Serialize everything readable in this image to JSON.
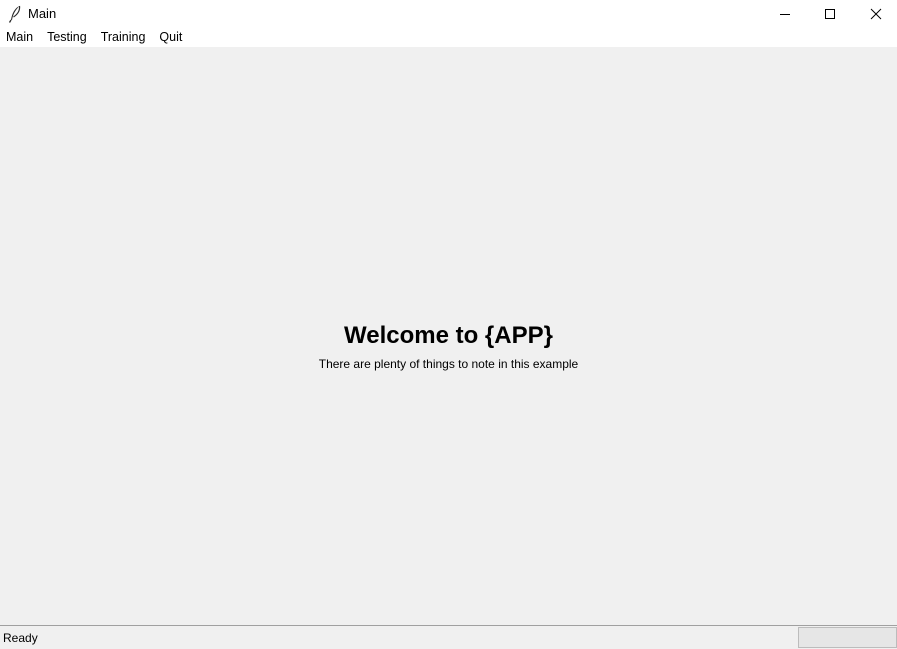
{
  "window": {
    "title": "Main",
    "icon": "feather-icon",
    "controls": [
      "minimize-icon",
      "maximize-icon",
      "close-icon"
    ]
  },
  "menu": {
    "items": [
      "Main",
      "Testing",
      "Training",
      "Quit"
    ]
  },
  "main": {
    "title": "Welcome to {APP}",
    "subtitle": "There are plenty of things to note in this example"
  },
  "status": {
    "text": "Ready",
    "progress_fraction": 0
  }
}
